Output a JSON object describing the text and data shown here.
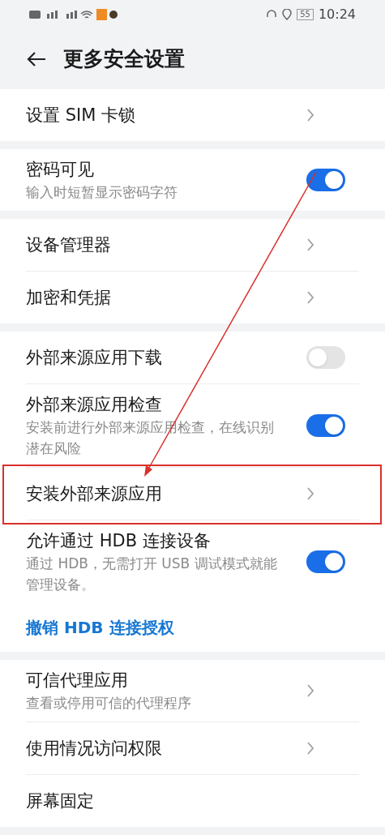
{
  "status_bar": {
    "time": "10:24",
    "battery": "55"
  },
  "header": {
    "title": "更多安全设置"
  },
  "groups": [
    {
      "items": [
        {
          "kind": "link",
          "label": "设置 SIM 卡锁"
        }
      ]
    },
    {
      "items": [
        {
          "kind": "toggle",
          "label": "密码可见",
          "subtitle": "输入时短暂显示密码字符",
          "on": true
        }
      ]
    },
    {
      "items": [
        {
          "kind": "link",
          "label": "设备管理器"
        },
        {
          "kind": "link",
          "label": "加密和凭据"
        }
      ]
    },
    {
      "items": [
        {
          "kind": "toggle",
          "label": "外部来源应用下载",
          "on": false
        },
        {
          "kind": "toggle",
          "label": "外部来源应用检查",
          "subtitle": "安装前进行外部来源应用检查，在线识别潜在风险",
          "on": true
        },
        {
          "kind": "link",
          "label": "安装外部来源应用"
        },
        {
          "kind": "toggle",
          "label": "允许通过 HDB 连接设备",
          "subtitle": "通过 HDB，无需打开 USB 调试模式就能管理设备。",
          "on": true
        },
        {
          "kind": "action",
          "label": "撤销 HDB 连接授权"
        }
      ]
    },
    {
      "items": [
        {
          "kind": "link",
          "label": "可信代理应用",
          "subtitle": "查看或停用可信的代理程序"
        },
        {
          "kind": "link",
          "label": "使用情况访问权限"
        },
        {
          "kind": "plain",
          "label": "屏幕固定"
        }
      ]
    }
  ]
}
